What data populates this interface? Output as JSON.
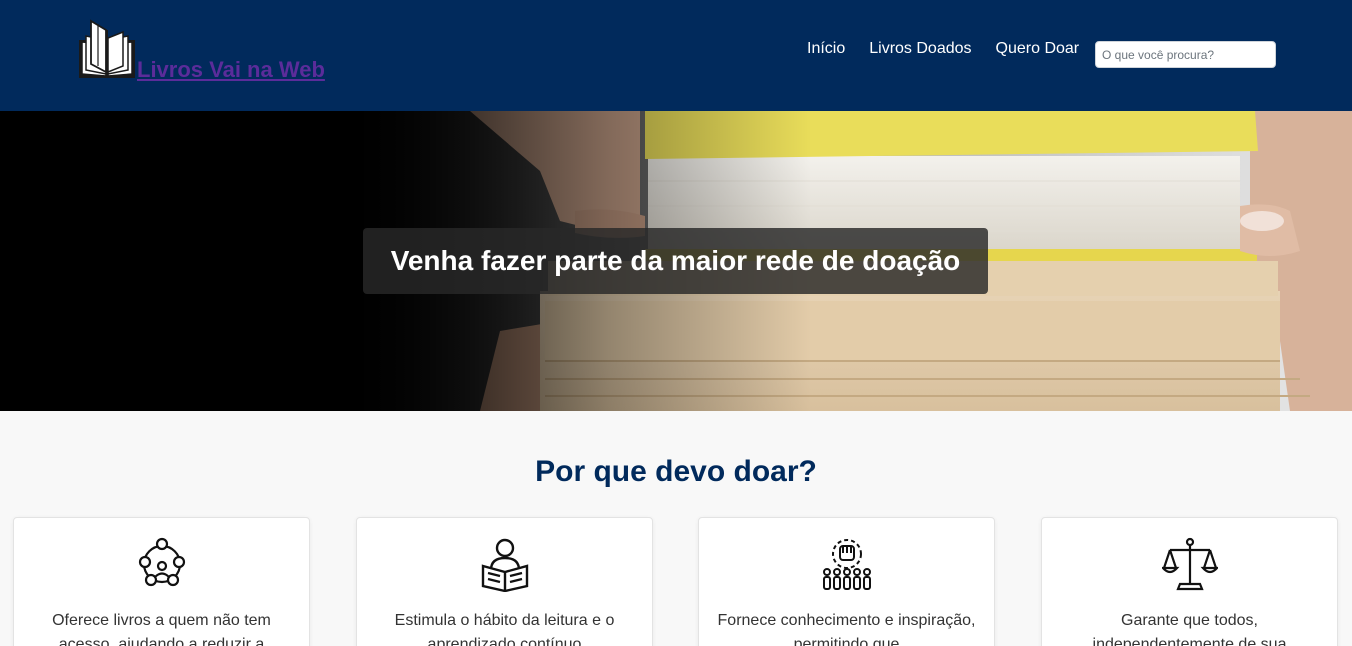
{
  "header": {
    "brand": "Livros Vai na Web",
    "logo_icon": "open-book-icon",
    "nav": [
      {
        "label": "Início"
      },
      {
        "label": "Livros Doados"
      },
      {
        "label": "Quero Doar"
      }
    ],
    "search": {
      "placeholder": "O que você procura?",
      "value": ""
    }
  },
  "hero": {
    "caption": "Venha fazer parte da maior rede de doação",
    "image": "hands-holding-book-stack"
  },
  "why": {
    "title": "Por que devo doar?",
    "cards": [
      {
        "icon": "community-network-icon",
        "text": "Oferece livros a quem não tem acesso, ajudando a reduzir a"
      },
      {
        "icon": "person-reading-icon",
        "text": "Estimula o hábito da leitura e o aprendizado contínuo"
      },
      {
        "icon": "raised-fist-crowd-icon",
        "text": "Fornece conhecimento e inspiração, permitindo que"
      },
      {
        "icon": "scales-of-justice-icon",
        "text": "Garante que todos, independentemente de sua"
      }
    ]
  },
  "colors": {
    "header_bg": "#012a5c",
    "brand_text": "#5b2c9a",
    "title": "#012a5c",
    "page_bg": "#f8f8f8"
  }
}
